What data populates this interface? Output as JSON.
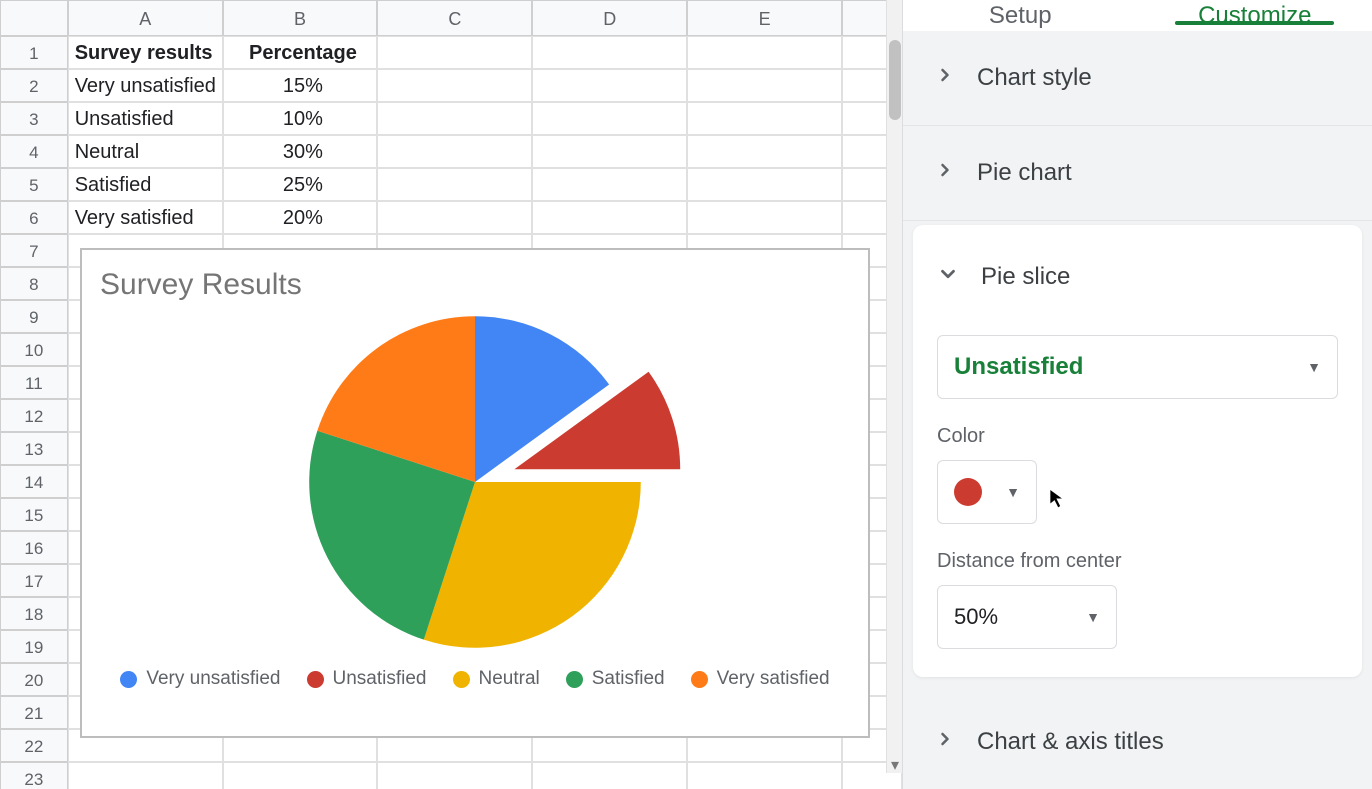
{
  "spreadsheet": {
    "columns": [
      "A",
      "B",
      "C",
      "D",
      "E"
    ],
    "rows_visible": 23,
    "headers": {
      "a": "Survey results",
      "b": "Percentage"
    },
    "data": [
      {
        "label": "Very unsatisfied",
        "value": "15%"
      },
      {
        "label": "Unsatisfied",
        "value": "10%"
      },
      {
        "label": "Neutral",
        "value": "30%"
      },
      {
        "label": "Satisfied",
        "value": "25%"
      },
      {
        "label": "Very satisfied",
        "value": "20%"
      }
    ]
  },
  "chart_data": {
    "type": "pie",
    "title": "Survey Results",
    "categories": [
      "Very unsatisfied",
      "Unsatisfied",
      "Neutral",
      "Satisfied",
      "Very satisfied"
    ],
    "values": [
      15,
      10,
      30,
      25,
      20
    ],
    "colors": [
      "#4285f4",
      "#cc3b30",
      "#f0b400",
      "#2ea05a",
      "#ff7b17"
    ],
    "exploded": {
      "index": 1,
      "distance_pct": 50
    }
  },
  "sidepanel": {
    "tabs": {
      "setup": "Setup",
      "customize": "Customize",
      "active": "customize"
    },
    "sections": {
      "chart_style": "Chart style",
      "pie_chart": "Pie chart",
      "pie_slice": "Pie slice",
      "chart_axis_titles": "Chart & axis titles"
    },
    "pie_slice": {
      "selected": "Unsatisfied",
      "color_label": "Color",
      "color_value": "#cc3b30",
      "distance_label": "Distance from center",
      "distance_value": "50%"
    }
  }
}
